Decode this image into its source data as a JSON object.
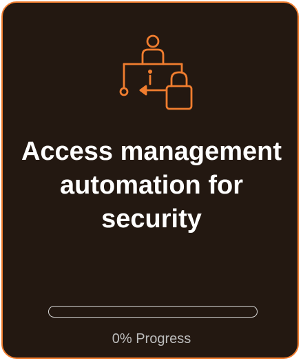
{
  "card": {
    "title": "Access management automation for security",
    "icon": "access-lock-icon",
    "progress": {
      "value": 0,
      "label": "0% Progress"
    }
  },
  "colors": {
    "accent": "#f07d2f",
    "background": "#231811",
    "title_text": "#ffffff",
    "muted_text": "#bdbdbd"
  }
}
